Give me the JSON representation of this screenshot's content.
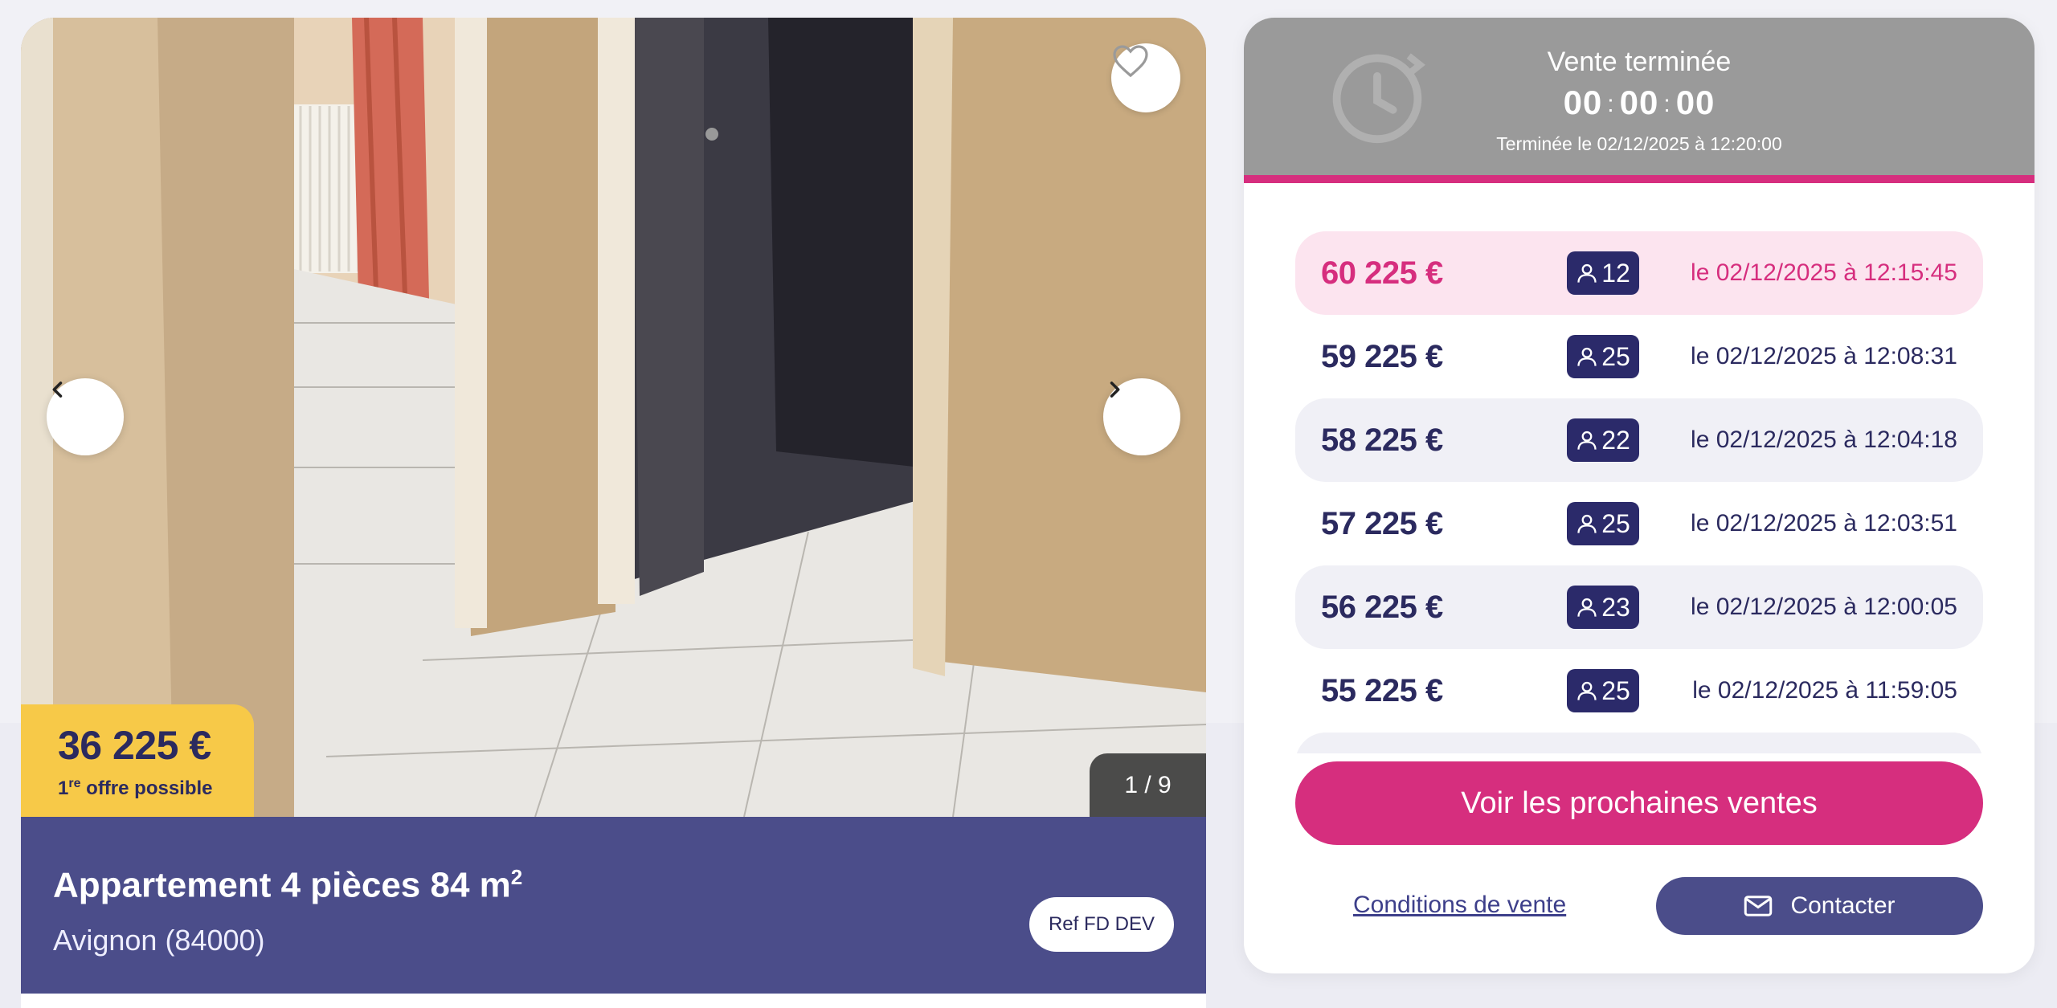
{
  "gallery": {
    "counter": "1 / 9",
    "favorite_icon": "heart-icon",
    "prev_icon": "chevron-left-icon",
    "next_icon": "chevron-right-icon"
  },
  "price_tag": {
    "amount": "36 225 €",
    "sub_prefix": "1",
    "sub_sup": "re",
    "sub_rest": " offre possible"
  },
  "property": {
    "title": "Appartement 4 pièces 84 m",
    "title_sup": "2",
    "city": "Avignon (84000)",
    "ref": "Ref FD DEV"
  },
  "sale": {
    "status": "Vente terminée",
    "timer": {
      "h": "00",
      "m": "00",
      "s": "00",
      "sep": ":"
    },
    "ended_at": "Terminée le 02/12/2025 à 12:20:00",
    "bids": [
      {
        "amount": "60 225 €",
        "bidders": "12",
        "date": "le 02/12/2025 à 12:15:45",
        "style": "win"
      },
      {
        "amount": "59 225 €",
        "bidders": "25",
        "date": "le 02/12/2025 à 12:08:31",
        "style": "plain"
      },
      {
        "amount": "58 225 €",
        "bidders": "22",
        "date": "le 02/12/2025 à 12:04:18",
        "style": "alt"
      },
      {
        "amount": "57 225 €",
        "bidders": "25",
        "date": "le 02/12/2025 à 12:03:51",
        "style": "plain"
      },
      {
        "amount": "56 225 €",
        "bidders": "23",
        "date": "le 02/12/2025 à 12:00:05",
        "style": "alt"
      },
      {
        "amount": "55 225 €",
        "bidders": "25",
        "date": "le 02/12/2025 à 11:59:05",
        "style": "plain"
      }
    ],
    "cta_label": "Voir les prochaines ventes",
    "conditions_label": "Conditions de vente",
    "contact_label": "Contacter"
  },
  "colors": {
    "accent": "#d62e7e",
    "navy": "#2b2a5f",
    "banner": "#4b4d8a",
    "yellow": "#f7c948",
    "header_grey": "#9a9a9a"
  }
}
